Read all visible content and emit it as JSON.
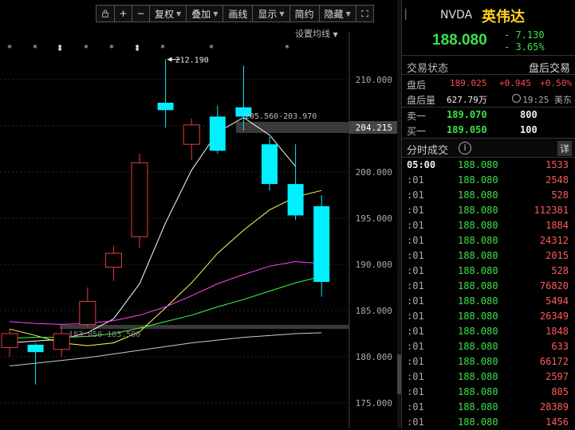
{
  "toolbar": {
    "buttons": [
      "",
      "+",
      "−",
      "复权",
      "叠加",
      "画线",
      "显示",
      "简约",
      "隐藏"
    ],
    "lock_icon": "lock-icon",
    "expand_icon": "expand-icon"
  },
  "ma_setting": "设置均线",
  "ask_line_label": "204.215",
  "annotations": {
    "high_label": "212.190",
    "range_label": "205.560-203.970",
    "low_range_label": "183.050-183.500"
  },
  "colors": {
    "up": "#e33e3e",
    "down": "#00f0ff",
    "ma5": "#ffffff",
    "ma10": "#ffff4d",
    "ma20": "#ff44ff",
    "ma30": "#44ff44",
    "ma60": "#cccccc"
  },
  "chart_data": {
    "type": "candlestick",
    "yticks": [
      210.0,
      205.0,
      200.0,
      195.0,
      190.0,
      185.0,
      180.0,
      175.0
    ],
    "ytick_labels": [
      "210.000",
      "205.000",
      "200.000",
      "195.000",
      "190.000",
      "185.000",
      "180.000",
      "175.000"
    ],
    "ylim": [
      174.0,
      216.0
    ],
    "event_markers": [
      "*",
      "*",
      "⬍",
      "*",
      "*",
      "⬍",
      "*",
      "*",
      "*"
    ],
    "candles": [
      {
        "open": 181.0,
        "close": 182.5,
        "high": 183.0,
        "low": 180.0
      },
      {
        "open": 181.3,
        "close": 180.5,
        "high": 181.5,
        "low": 177.0
      },
      {
        "open": 180.8,
        "close": 182.5,
        "high": 183.2,
        "low": 180.0
      },
      {
        "open": 183.5,
        "close": 186.0,
        "high": 187.5,
        "low": 183.2
      },
      {
        "open": 189.7,
        "close": 191.2,
        "high": 192.0,
        "low": 188.2
      },
      {
        "open": 193.0,
        "close": 201.0,
        "high": 202.0,
        "low": 191.8
      },
      {
        "open": 207.5,
        "close": 206.7,
        "high": 212.19,
        "low": 204.8
      },
      {
        "open": 203.0,
        "close": 205.1,
        "high": 205.8,
        "low": 201.3
      },
      {
        "open": 206.0,
        "close": 202.3,
        "high": 207.2,
        "low": 202.0
      },
      {
        "open": 207.0,
        "close": 206.0,
        "high": 211.5,
        "low": 204.5
      },
      {
        "open": 203.0,
        "close": 198.7,
        "high": 203.8,
        "low": 198.0
      },
      {
        "open": 198.7,
        "close": 195.3,
        "high": 203.0,
        "low": 194.8
      },
      {
        "open": 196.3,
        "close": 188.1,
        "high": 197.5,
        "low": 186.5
      }
    ],
    "ma_lines": [
      {
        "name": "MA5",
        "values": [
          181.5,
          181.7,
          181.9,
          182.6,
          184.1,
          187.9,
          194.5,
          200.2,
          204.3,
          205.9,
          204.0,
          200.6
        ]
      },
      {
        "name": "MA10",
        "values": [
          183.0,
          182.3,
          181.5,
          181.2,
          181.5,
          182.7,
          185.3,
          188.0,
          191.2,
          193.7,
          195.9,
          197.3,
          198.0
        ]
      },
      {
        "name": "MA20",
        "values": [
          183.8,
          183.6,
          183.5,
          183.6,
          183.9,
          184.5,
          185.4,
          186.6,
          187.9,
          188.9,
          189.8,
          190.3,
          190.1
        ]
      },
      {
        "name": "MA30",
        "values": [
          182.0,
          182.1,
          182.1,
          182.2,
          182.5,
          183.1,
          183.8,
          184.5,
          185.4,
          186.2,
          187.1,
          188.0,
          188.7
        ]
      },
      {
        "name": "MA60",
        "values": [
          179.0,
          179.3,
          179.6,
          179.9,
          180.3,
          180.7,
          181.1,
          181.5,
          181.8,
          182.1,
          182.3,
          182.5,
          182.6
        ]
      }
    ]
  },
  "quote": {
    "symbol": "NVDA",
    "name": "英伟达",
    "last": "188.080",
    "change": "- 7.130",
    "change_pct": "- 3.65%",
    "trade_status_label": "交易状态",
    "trade_status": "盘后交易",
    "after_label": "盘后",
    "after_price": "189.025",
    "after_chg": "+0.945",
    "after_pct": "+0.50%",
    "after_vol_label": "盘后量",
    "after_vol": "627.79万",
    "after_time": "19:25 美东",
    "ask_label": "卖一",
    "ask_price": "189.070",
    "ask_size": "800",
    "bid_label": "买一",
    "bid_price": "189.050",
    "bid_size": "100",
    "ticks_title": "分时成交",
    "detail": "详"
  },
  "ticks": [
    {
      "t": "05:00",
      "p": "188.080",
      "v": "1533"
    },
    {
      "t": ":01",
      "p": "188.080",
      "v": "2548"
    },
    {
      "t": ":01",
      "p": "188.080",
      "v": "528"
    },
    {
      "t": ":01",
      "p": "188.080",
      "v": "112381"
    },
    {
      "t": ":01",
      "p": "188.080",
      "v": "1884"
    },
    {
      "t": ":01",
      "p": "188.080",
      "v": "24312"
    },
    {
      "t": ":01",
      "p": "188.080",
      "v": "2015"
    },
    {
      "t": ":01",
      "p": "188.080",
      "v": "528"
    },
    {
      "t": ":01",
      "p": "188.080",
      "v": "76820"
    },
    {
      "t": ":01",
      "p": "188.080",
      "v": "5494"
    },
    {
      "t": ":01",
      "p": "188.080",
      "v": "26349"
    },
    {
      "t": ":01",
      "p": "188.080",
      "v": "1848"
    },
    {
      "t": ":01",
      "p": "188.080",
      "v": "633"
    },
    {
      "t": ":01",
      "p": "188.080",
      "v": "66172"
    },
    {
      "t": ":01",
      "p": "188.080",
      "v": "2597"
    },
    {
      "t": ":01",
      "p": "188.080",
      "v": "805"
    },
    {
      "t": ":01",
      "p": "188.080",
      "v": "28389"
    },
    {
      "t": ":01",
      "p": "188.080",
      "v": "1456"
    }
  ]
}
